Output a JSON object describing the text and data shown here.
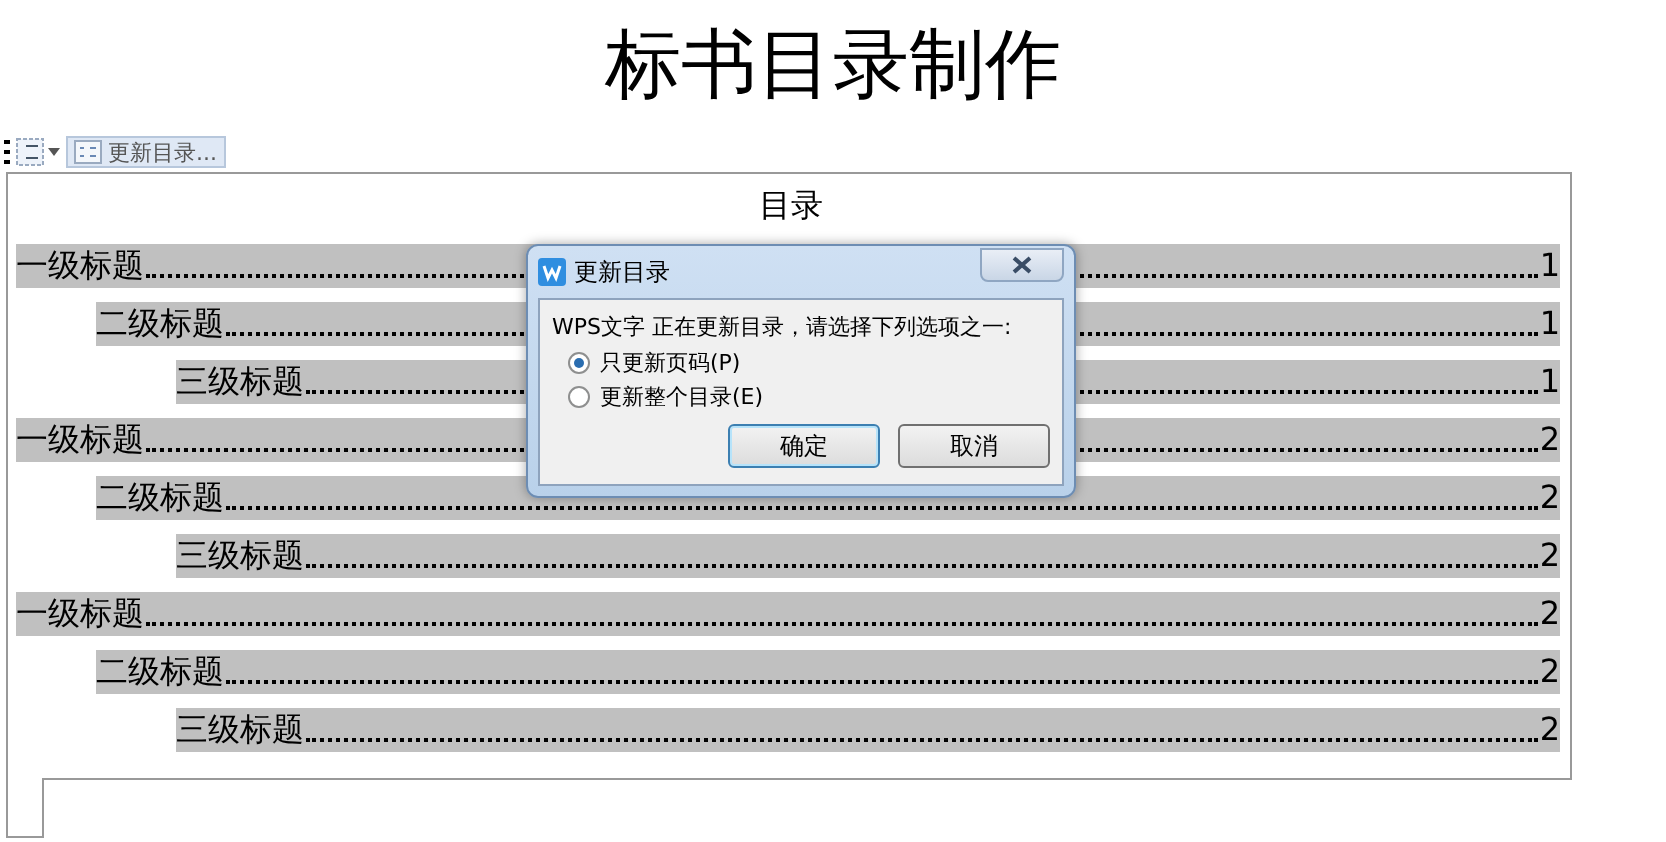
{
  "page_title": "标书目录制作",
  "toolbar": {
    "button_label": "更新目录..."
  },
  "toc": {
    "heading": "目录",
    "entries": [
      {
        "title": "一级标题",
        "page": "1",
        "children": [
          {
            "title": "二级标题",
            "page": "1",
            "children": [
              {
                "title": "三级标题",
                "page": "1"
              }
            ]
          }
        ]
      },
      {
        "title": "一级标题",
        "page": "2",
        "children": [
          {
            "title": "二级标题",
            "page": "2",
            "children": [
              {
                "title": "三级标题",
                "page": "2"
              }
            ]
          }
        ]
      },
      {
        "title": "一级标题",
        "page": "2",
        "children": [
          {
            "title": "二级标题",
            "page": "2",
            "children": [
              {
                "title": "三级标题",
                "page": "2"
              }
            ]
          }
        ]
      }
    ]
  },
  "dialog": {
    "title": "更新目录",
    "message": "WPS文字 正在更新目录，请选择下列选项之一:",
    "options": [
      {
        "label": "只更新页码(P)",
        "selected": true
      },
      {
        "label": "更新整个目录(E)",
        "selected": false
      }
    ],
    "buttons": [
      {
        "label": "确定",
        "default": true
      },
      {
        "label": "取消",
        "default": false
      }
    ]
  }
}
